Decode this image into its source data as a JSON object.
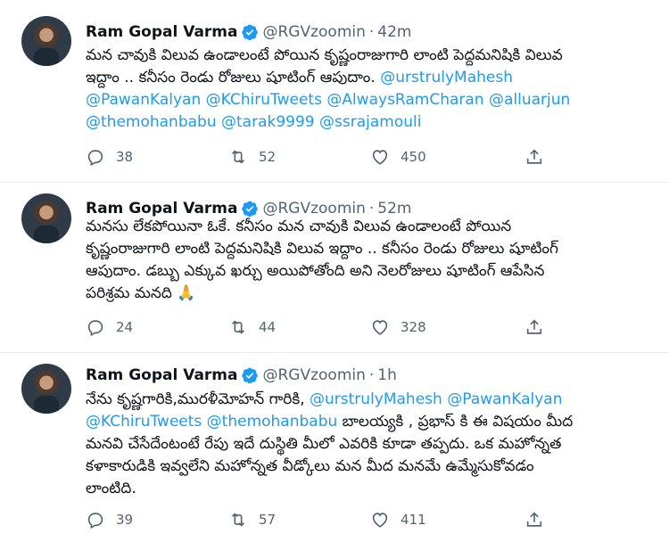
{
  "colors": {
    "mention": "#1d9bf0",
    "muted": "#536471",
    "verified": "#1d9bf0",
    "text": "#0f1419"
  },
  "tweets": [
    {
      "name": "Ram Gopal Varma",
      "handle": "@RGVzoomin",
      "sep": "·",
      "time": "42m",
      "lines": [
        [
          {
            "t": "మన చావుకి విలువ ఉండాలంటే పోయిన కృష్ణంరాజుగారి లాంటి  పెద్దమనిషికి విలువ"
          }
        ],
        [
          {
            "t": "ఇద్దాం .. కనీసం రెండు రోజులు షూటింగ్ ఆపుదాం. "
          },
          {
            "t": "@urstrulyMahesh",
            "m": true
          }
        ],
        [
          {
            "t": "@PawanKalyan",
            "m": true
          },
          {
            "t": " "
          },
          {
            "t": "@KChiruTweets",
            "m": true
          },
          {
            "t": " "
          },
          {
            "t": "@AlwaysRamCharan",
            "m": true
          },
          {
            "t": " "
          },
          {
            "t": "@alluarjun",
            "m": true
          }
        ],
        [
          {
            "t": "@themohanbabu",
            "m": true
          },
          {
            "t": "  "
          },
          {
            "t": "@tarak9999",
            "m": true
          },
          {
            "t": " "
          },
          {
            "t": "@ssrajamouli",
            "m": true
          }
        ]
      ],
      "replies": "38",
      "retweets": "52",
      "likes": "450"
    },
    {
      "name": "Ram Gopal Varma",
      "handle": "@RGVzoomin",
      "sep": "·",
      "time": "52m",
      "lines": [
        [
          {
            "t": "మనసు లేకపోయినా ఓకే. కనీసం మన చావుకి విలువ  ఉండాలంటే పోయిన"
          }
        ],
        [
          {
            "t": "కృష్ణంరాజుగారి లాంటి  పెద్దమనిషికి విలువ ఇద్దాం .. కనీసం రెండు రోజులు షూటింగ్"
          }
        ],
        [
          {
            "t": "ఆపుదాం. డబ్బు ఎక్కువ ఖర్చు అయిపోతోంది అని నెలరోజులు షూటింగ్ ఆపేసిన"
          }
        ],
        [
          {
            "t": "పరిశ్రమ మనది 🙏"
          }
        ]
      ],
      "replies": "24",
      "retweets": "44",
      "likes": "328"
    },
    {
      "name": "Ram Gopal Varma",
      "handle": "@RGVzoomin",
      "sep": "·",
      "time": "1h",
      "lines": [
        [
          {
            "t": "నేను కృష్ణగారికి,మురళీమోహన్ గారికి, "
          },
          {
            "t": "@urstrulyMahesh",
            "m": true
          },
          {
            "t": " "
          },
          {
            "t": "@PawanKalyan",
            "m": true
          }
        ],
        [
          {
            "t": "@KChiruTweets",
            "m": true
          },
          {
            "t": " "
          },
          {
            "t": "@themohanbabu",
            "m": true
          },
          {
            "t": "   బాలయ్యకి , ప్రభాస్ కి ఈ విషయం మీద"
          }
        ],
        [
          {
            "t": "మనవి చేసేదేంటంటే రేపు ఇదే దుస్థితి మీలో ఎవరికి కూడా తప్పదు. ఒక మహోన్నత"
          }
        ],
        [
          {
            "t": "కళాకారుడికి ఇవ్వలేని మహోన్నత వీడ్కోలు మన మీద మనమే ఉమ్మేసుకోవడం"
          }
        ],
        [
          {
            "t": "లాంటిది."
          }
        ]
      ],
      "replies": "39",
      "retweets": "57",
      "likes": "411"
    }
  ]
}
